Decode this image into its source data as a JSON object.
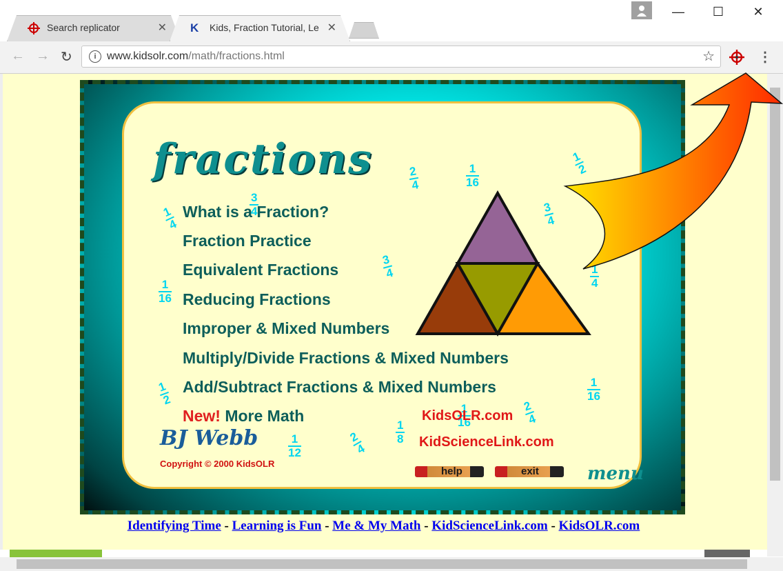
{
  "browser": {
    "tabs": [
      {
        "title": "Search replicator",
        "active": false
      },
      {
        "title": "Kids, Fraction Tutorial, Le",
        "active": true
      }
    ],
    "tab_close": "✕",
    "window_controls": {
      "minimize": "—",
      "maximize": "☐",
      "close": "✕"
    },
    "url_host": "www.kidsolr.com",
    "url_path": "/math/fractions.html"
  },
  "page": {
    "heading": "fractions",
    "menu_items": [
      "What is a Fraction?",
      "Fraction Practice",
      "Equivalent Fractions",
      "Reducing Fractions",
      "Improper & Mixed Numbers",
      "Multiply/Divide Fractions & Mixed Numbers",
      "Add/Subtract Fractions & Mixed Numbers"
    ],
    "new_label": "New!",
    "more_math": "More Math",
    "site_links": [
      "KidsOLR.com",
      "KidScienceLink.com"
    ],
    "signature": "BJ Webb",
    "copyright": "Copyright © 2000 KidsOLR",
    "help_label": "help",
    "exit_label": "exit",
    "menu_word": "menu",
    "fractions": [
      {
        "num": "2",
        "den": "4"
      },
      {
        "num": "1",
        "den": "16"
      },
      {
        "num": "1",
        "den": "2"
      },
      {
        "num": "3",
        "den": "4"
      },
      {
        "num": "1",
        "den": "4"
      },
      {
        "num": "3",
        "den": "4"
      },
      {
        "num": "3",
        "den": "4"
      },
      {
        "num": "1",
        "den": "16"
      },
      {
        "num": "1",
        "den": "4"
      },
      {
        "num": "1",
        "den": "2"
      },
      {
        "num": "1",
        "den": "16"
      },
      {
        "num": "1",
        "den": "16"
      },
      {
        "num": "2",
        "den": "4"
      },
      {
        "num": "1",
        "den": "8"
      },
      {
        "num": "1",
        "den": "12"
      },
      {
        "num": "2",
        "den": "4"
      }
    ],
    "bottom_links": [
      "Identifying Time",
      "Learning is Fun",
      "Me & My Math",
      "KidScienceLink.com",
      "KidsOLR.com"
    ],
    "bottom_sep": "-"
  },
  "colors": {
    "triangle_top": "#956496",
    "triangle_left": "#983c0a",
    "triangle_middle": "#979b00",
    "triangle_right": "#ff9b05",
    "arrow_start": "#ffe600",
    "arrow_end": "#ff2a00"
  }
}
